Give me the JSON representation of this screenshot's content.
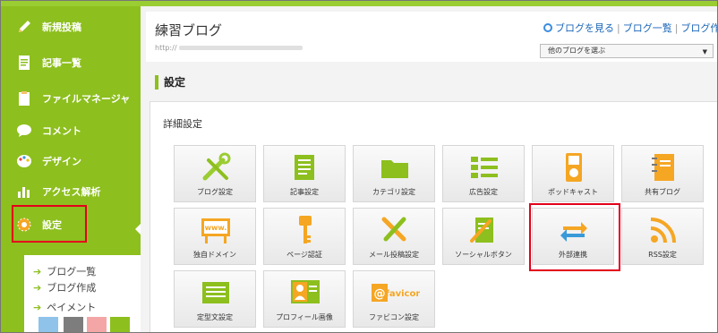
{
  "sidebar": {
    "items": [
      {
        "label": "新規投稿",
        "icon": "pencil-icon"
      },
      {
        "label": "記事一覧",
        "icon": "document-icon"
      },
      {
        "label": "ファイルマネージャ",
        "icon": "file-manager-icon"
      },
      {
        "label": "コメント",
        "icon": "comment-icon"
      },
      {
        "label": "デザイン",
        "icon": "palette-icon"
      },
      {
        "label": "アクセス解析",
        "icon": "bar-chart-icon"
      },
      {
        "label": "設定",
        "icon": "gear-icon"
      }
    ],
    "sub_items": [
      "ブログ一覧",
      "ブログ作成",
      "ペイメント"
    ],
    "swatches": [
      "#8fc3ea",
      "#7d7d7d",
      "#f4a6a6",
      "#8dbf1e"
    ]
  },
  "header": {
    "blog_title": "練習ブログ",
    "url_prefix": "http://",
    "links": [
      "ブログを見る",
      "ブログ一覧",
      "ブログ作"
    ],
    "blog_select_value": "他のブログを選ぶ"
  },
  "page_title": "設定",
  "panel": {
    "title": "詳細設定",
    "tiles": [
      {
        "label": "ブログ設定",
        "icon": "tools-icon"
      },
      {
        "label": "記事設定",
        "icon": "document-icon"
      },
      {
        "label": "カテゴリ設定",
        "icon": "folder-icon"
      },
      {
        "label": "広告設定",
        "icon": "list-icon"
      },
      {
        "label": "ポッドキャスト",
        "icon": "ipod-icon"
      },
      {
        "label": "共有ブログ",
        "icon": "notebook-icon"
      },
      {
        "label": "独自ドメイン",
        "icon": "www-sign-icon"
      },
      {
        "label": "ページ認証",
        "icon": "key-icon"
      },
      {
        "label": "メール投稿設定",
        "icon": "wrench-pencil-icon"
      },
      {
        "label": "ソーシャルボタン",
        "icon": "pen-paper-icon"
      },
      {
        "label": "外部連携",
        "icon": "sync-arrows-icon"
      },
      {
        "label": "RSS設定",
        "icon": "rss-icon"
      },
      {
        "label": "定型文設定",
        "icon": "template-icon"
      },
      {
        "label": "プロフィール画像",
        "icon": "profile-card-icon"
      },
      {
        "label": "ファビコン設定",
        "icon": "favicon-icon"
      }
    ],
    "favicon_badge": "favicon",
    "www_badge": "www."
  },
  "colors": {
    "accent": "#8dbf1e",
    "highlight": "#e3001b",
    "link": "#1a66b8"
  }
}
